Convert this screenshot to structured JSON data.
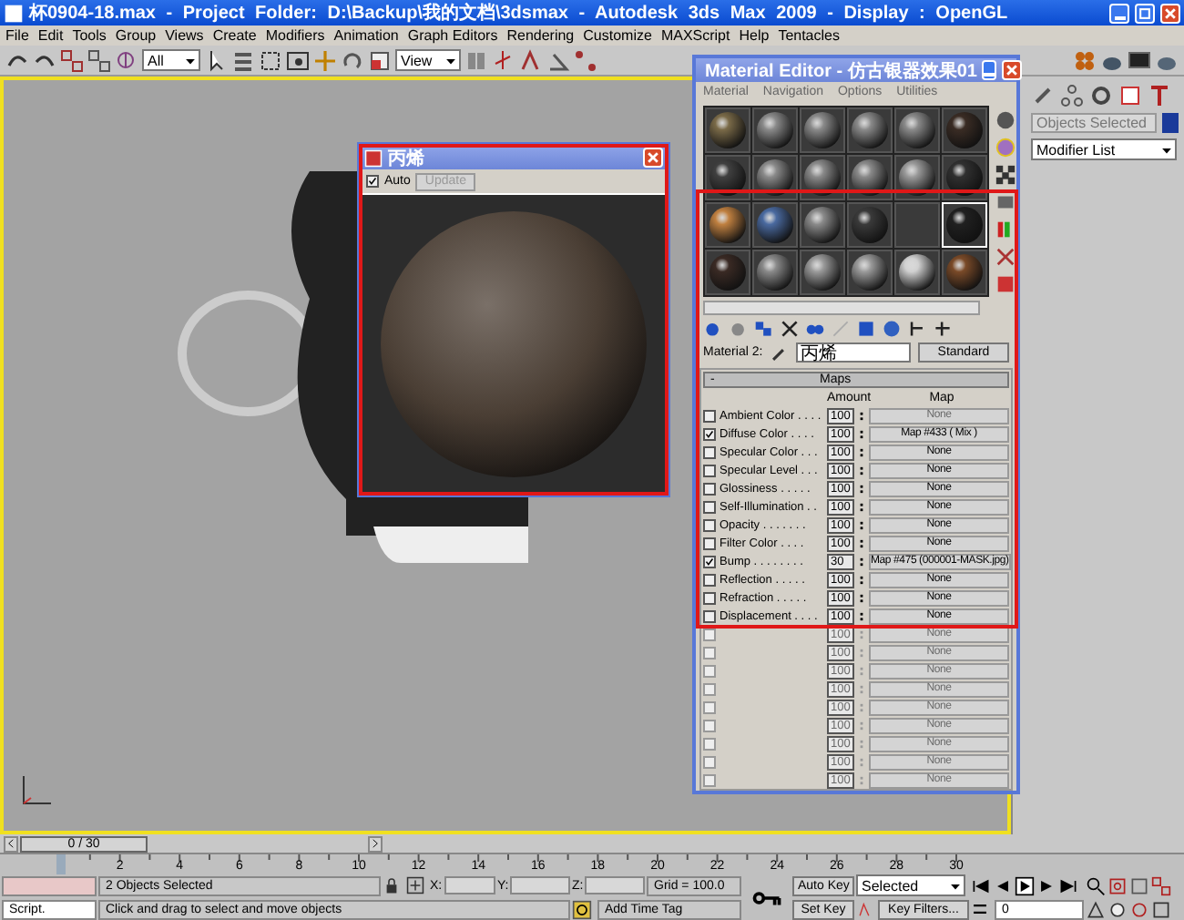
{
  "window": {
    "title": "杯0904-18.max - Project Folder: D:\\Backup\\我的文档\\3dsmax - Autodesk 3ds Max 2009 - Display : OpenGL"
  },
  "menu": [
    "File",
    "Edit",
    "Tools",
    "Group",
    "Views",
    "Create",
    "Modifiers",
    "Animation",
    "Graph Editors",
    "Rendering",
    "Customize",
    "MAXScript",
    "Help",
    "Tentacles"
  ],
  "toolbar": {
    "selection_filter": "All",
    "reference_coordinate_system": "View"
  },
  "render_window": {
    "title": "丙烯",
    "auto": {
      "label": "Auto",
      "checked": true
    },
    "update": {
      "label": "Update",
      "disabled": true
    }
  },
  "material_editor": {
    "title": "Material Editor - 仿古银器效果01",
    "menu": [
      "Material",
      "Navigation",
      "Options",
      "Utilities"
    ],
    "sample_slots": [
      {
        "selected": false
      },
      {
        "selected": false
      },
      {
        "selected": false
      },
      {
        "selected": false
      },
      {
        "selected": false
      },
      {
        "selected": false
      },
      {
        "selected": false
      },
      {
        "selected": false
      },
      {
        "selected": false
      },
      {
        "selected": false
      },
      {
        "selected": false
      },
      {
        "selected": false
      },
      {
        "selected": false
      },
      {
        "selected": false
      },
      {
        "selected": false
      },
      {
        "selected": false
      },
      {
        "selected": false
      },
      {
        "selected": true
      },
      {
        "selected": false
      },
      {
        "selected": false
      },
      {
        "selected": false
      },
      {
        "selected": false
      },
      {
        "selected": false
      },
      {
        "selected": false
      }
    ],
    "material_label": "Material 2:",
    "material_name": "丙烯",
    "type_button": "Standard",
    "maps": {
      "collapse": "-",
      "title": "Maps",
      "amount_header": "Amount",
      "map_header": "Map",
      "rows": [
        {
          "name": "Ambient Color . . . .",
          "checked": false,
          "amount": "100",
          "map": "None",
          "disabled": false,
          "map_disabled": true
        },
        {
          "name": "Diffuse Color . . . .",
          "checked": true,
          "amount": "100",
          "map": "Map #433  ( Mix )",
          "disabled": false,
          "map_disabled": false
        },
        {
          "name": "Specular Color . . .",
          "checked": false,
          "amount": "100",
          "map": "None",
          "disabled": false,
          "map_disabled": false
        },
        {
          "name": "Specular Level . . .",
          "checked": false,
          "amount": "100",
          "map": "None",
          "disabled": false,
          "map_disabled": false
        },
        {
          "name": "Glossiness . . . . .",
          "checked": false,
          "amount": "100",
          "map": "None",
          "disabled": false,
          "map_disabled": false
        },
        {
          "name": "Self-Illumination . .",
          "checked": false,
          "amount": "100",
          "map": "None",
          "disabled": false,
          "map_disabled": false
        },
        {
          "name": "Opacity . . . . . . .",
          "checked": false,
          "amount": "100",
          "map": "None",
          "disabled": false,
          "map_disabled": false
        },
        {
          "name": "Filter Color . . . .",
          "checked": false,
          "amount": "100",
          "map": "None",
          "disabled": false,
          "map_disabled": false
        },
        {
          "name": "Bump . . . . . . . .",
          "checked": true,
          "amount": "30",
          "map": "Map #475 (000001-MASK.jpg)",
          "disabled": false,
          "map_disabled": false
        },
        {
          "name": "Reflection . . . . .",
          "checked": false,
          "amount": "100",
          "map": "None",
          "disabled": false,
          "map_disabled": false
        },
        {
          "name": "Refraction . . . . .",
          "checked": false,
          "amount": "100",
          "map": "None",
          "disabled": false,
          "map_disabled": false
        },
        {
          "name": "Displacement . . . .",
          "checked": false,
          "amount": "100",
          "map": "None",
          "disabled": false,
          "map_disabled": false
        },
        {
          "checked": false,
          "amount": "100",
          "map": "None",
          "disabled": true,
          "map_disabled": true
        },
        {
          "checked": false,
          "amount": "100",
          "map": "None",
          "disabled": true,
          "map_disabled": true
        },
        {
          "checked": false,
          "amount": "100",
          "map": "None",
          "disabled": true,
          "map_disabled": true
        },
        {
          "checked": false,
          "amount": "100",
          "map": "None",
          "disabled": true,
          "map_disabled": true
        },
        {
          "checked": false,
          "amount": "100",
          "map": "None",
          "disabled": true,
          "map_disabled": true
        },
        {
          "checked": false,
          "amount": "100",
          "map": "None",
          "disabled": true,
          "map_disabled": true
        },
        {
          "checked": false,
          "amount": "100",
          "map": "None",
          "disabled": true,
          "map_disabled": true
        },
        {
          "checked": false,
          "amount": "100",
          "map": "None",
          "disabled": true,
          "map_disabled": true
        },
        {
          "checked": false,
          "amount": "100",
          "map": "None",
          "disabled": true,
          "map_disabled": true
        }
      ]
    }
  },
  "command_panel": {
    "selection_field": {
      "placeholder": "Objects Selected"
    },
    "modifier_list": "Modifier List"
  },
  "time_slider": {
    "label": "0 / 30",
    "level": 0
  },
  "trackbar": {
    "labels": [
      "2",
      "4",
      "6",
      "8",
      "10",
      "12",
      "14",
      "16",
      "18",
      "20",
      "22",
      "24",
      "26",
      "28",
      "30"
    ]
  },
  "status": {
    "listener": "Script.",
    "selection": "2 Objects Selected",
    "coord_labels": [
      "X:",
      "Y:",
      "Z:"
    ],
    "grid": "Grid = 100.0",
    "prompt": "Click and drag to select and move objects",
    "add_time_tag": "Add Time Tag",
    "auto_key": "Auto Key",
    "key_mode": "Selected",
    "set_key": "Set Key",
    "key_filters": "Key Filters...",
    "current_frame": "0"
  }
}
